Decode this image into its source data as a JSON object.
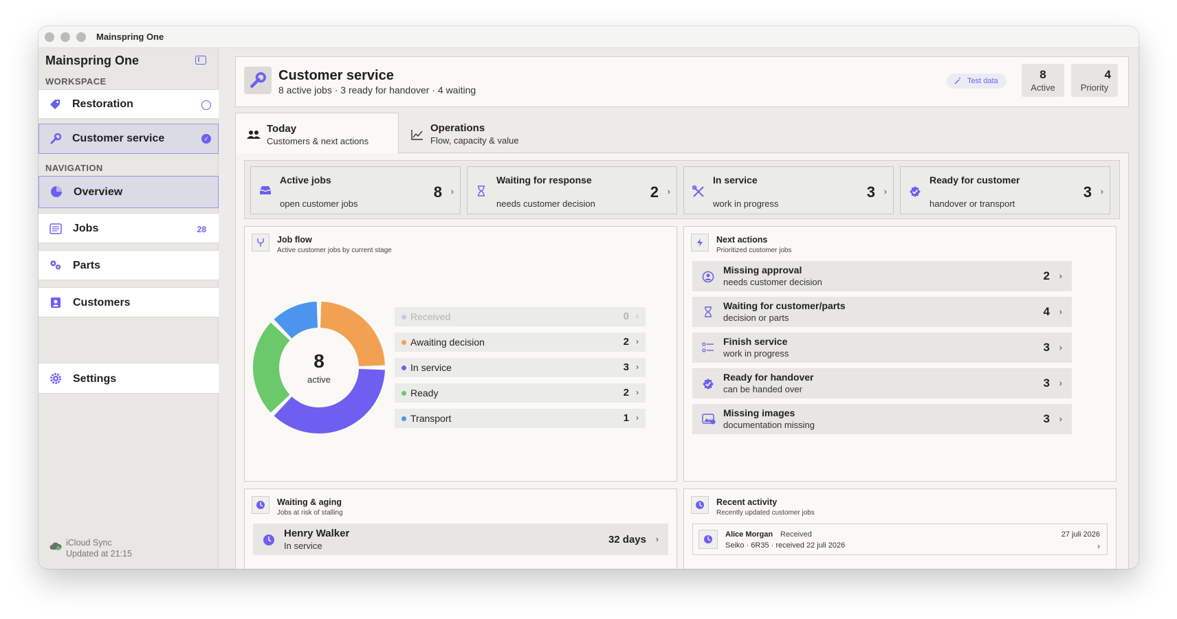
{
  "window": {
    "title": "Mainspring One"
  },
  "sidebar": {
    "app_title": "Mainspring One",
    "workspace_label": "WORKSPACE",
    "workspaces": [
      {
        "label": "Restoration",
        "icon": "tag-icon"
      },
      {
        "label": "Customer service",
        "icon": "wrench-icon"
      }
    ],
    "navigation_label": "NAVIGATION",
    "nav": [
      {
        "label": "Overview",
        "icon": "pie-chart-icon"
      },
      {
        "label": "Jobs",
        "icon": "list-icon",
        "badge": "28"
      },
      {
        "label": "Parts",
        "icon": "gears-icon"
      },
      {
        "label": "Customers",
        "icon": "contact-icon"
      }
    ],
    "settings_label": "Settings",
    "sync": {
      "title": "iCloud Sync",
      "status": "Updated at 21:15"
    }
  },
  "header": {
    "title": "Customer service",
    "subtitle": "8 active jobs · 3 ready for handover · 4 waiting",
    "test_data_label": "Test data",
    "stats": [
      {
        "value": "8",
        "label": "Active"
      },
      {
        "value": "4",
        "label": "Priority"
      }
    ]
  },
  "tabs": [
    {
      "title": "Today",
      "subtitle": "Customers & next actions"
    },
    {
      "title": "Operations",
      "subtitle": "Flow, capacity & value"
    }
  ],
  "kpis": [
    {
      "title": "Active jobs",
      "subtitle": "open customer jobs",
      "value": "8",
      "icon": "tray-icon"
    },
    {
      "title": "Waiting for response",
      "subtitle": "needs customer decision",
      "value": "2",
      "icon": "hourglass-icon"
    },
    {
      "title": "In service",
      "subtitle": "work in progress",
      "value": "3",
      "icon": "tools-icon"
    },
    {
      "title": "Ready for customer",
      "subtitle": "handover or transport",
      "value": "3",
      "icon": "checkmark-seal-icon"
    }
  ],
  "job_flow": {
    "title": "Job flow",
    "subtitle": "Active customer jobs by current stage",
    "center_value": "8",
    "center_label": "active",
    "chart_data": {
      "type": "pie",
      "categories": [
        "Received",
        "Awaiting decision",
        "In service",
        "Ready",
        "Transport"
      ],
      "values": [
        0,
        2,
        3,
        2,
        1
      ],
      "colors": [
        "#c9c5f5",
        "#f2a152",
        "#6e5ff0",
        "#6cc96b",
        "#4b95ef"
      ]
    }
  },
  "next_actions": {
    "title": "Next actions",
    "subtitle": "Prioritized customer jobs",
    "items": [
      {
        "title": "Missing approval",
        "subtitle": "needs customer decision",
        "value": "2",
        "icon": "person-question-icon"
      },
      {
        "title": "Waiting for customer/parts",
        "subtitle": "decision or parts",
        "value": "4",
        "icon": "hourglass-icon"
      },
      {
        "title": "Finish service",
        "subtitle": "work in progress",
        "value": "3",
        "icon": "checklist-icon"
      },
      {
        "title": "Ready for handover",
        "subtitle": "can be handed over",
        "value": "3",
        "icon": "checkmark-seal-icon"
      },
      {
        "title": "Missing images",
        "subtitle": "documentation missing",
        "value": "3",
        "icon": "photo-icon"
      }
    ]
  },
  "waiting": {
    "title": "Waiting & aging",
    "subtitle": "Jobs at risk of stalling",
    "rows": [
      {
        "name": "Henry Walker",
        "status": "In service",
        "age": "32 days"
      }
    ]
  },
  "activity": {
    "title": "Recent activity",
    "subtitle": "Recently updated customer jobs",
    "rows": [
      {
        "name": "Alice Morgan",
        "status": "Received",
        "date": "27 juli 2026",
        "detail": "Seiko · 6R35 · received 22 juli 2026"
      }
    ]
  },
  "colors": {
    "accent": "#6d5ff0"
  }
}
